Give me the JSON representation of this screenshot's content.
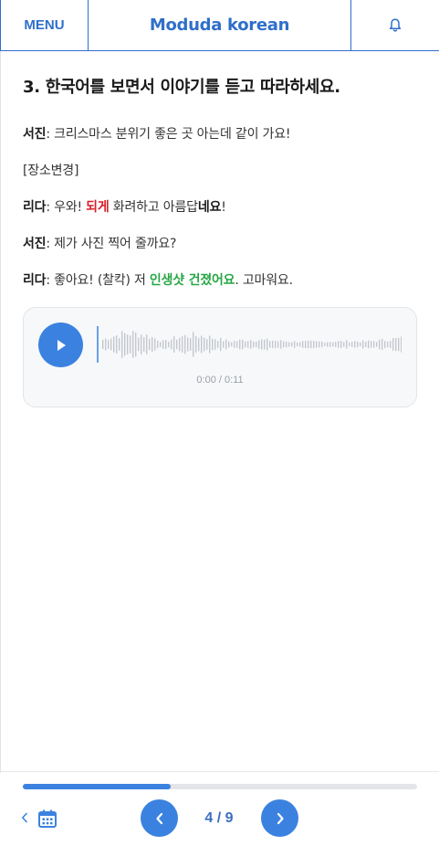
{
  "header": {
    "menu_label": "MENU",
    "logo_text": "Moduda korean",
    "bell_icon": "bell-icon"
  },
  "lesson": {
    "title": "3. 한국어를 보면서 이야기를 듣고 따라하세요.",
    "lines": [
      {
        "speaker": "서진",
        "parts": [
          {
            "text": ": 크리스마스 분위기 좋은 곳 아는데 같이 가요!",
            "style": "normal"
          }
        ]
      },
      {
        "speaker": "",
        "parts": [
          {
            "text": "[장소변경]",
            "style": "normal"
          }
        ]
      },
      {
        "speaker": "리다",
        "parts": [
          {
            "text": ": 우와! ",
            "style": "normal"
          },
          {
            "text": "되게",
            "style": "red"
          },
          {
            "text": " 화려하고 아름답",
            "style": "normal"
          },
          {
            "text": "네요",
            "style": "bold"
          },
          {
            "text": "!",
            "style": "normal"
          }
        ]
      },
      {
        "speaker": "서진",
        "parts": [
          {
            "text": ": 제가 사진 찍어 줄까요?",
            "style": "normal"
          }
        ]
      },
      {
        "speaker": "리다",
        "parts": [
          {
            "text": ": 좋아요! (찰칵) 저 ",
            "style": "normal"
          },
          {
            "text": "인생샷 건졌어요",
            "style": "green"
          },
          {
            "text": ". 고마워요.",
            "style": "normal"
          }
        ]
      }
    ]
  },
  "player": {
    "play_icon": "play-icon",
    "time_text": "0:00 / 0:11"
  },
  "footer": {
    "progress_fraction": 0.3755,
    "page_text": "4 / 9",
    "back_icon": "chevron-left-icon",
    "calendar_icon": "calendar-icon",
    "prev_icon": "prev-arrow-icon",
    "next_icon": "next-arrow-icon",
    "accent_color": "#3b82e0"
  }
}
